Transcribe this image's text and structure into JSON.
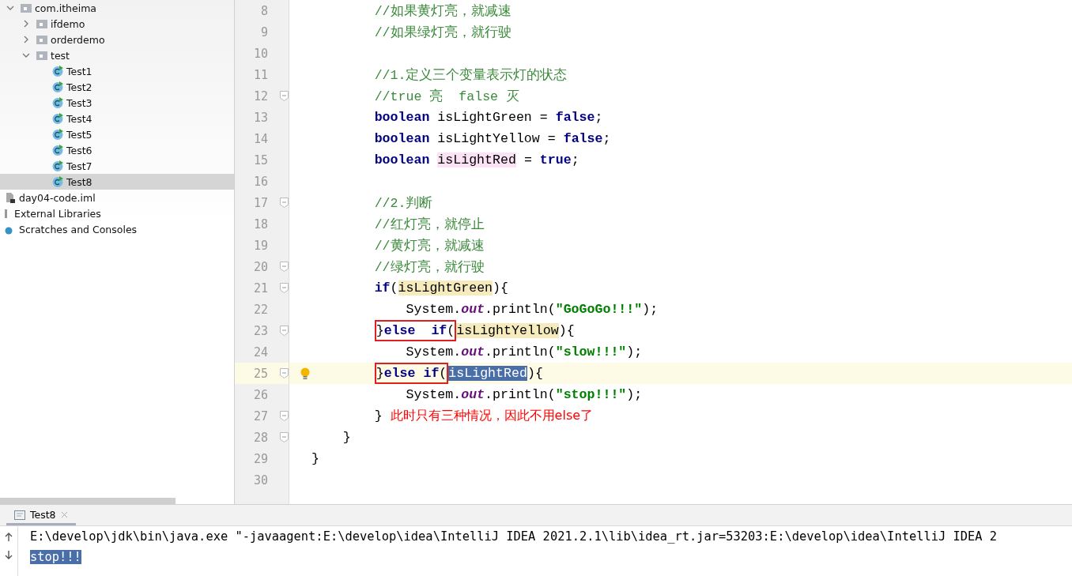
{
  "project_tree": [
    {
      "label": "com.itheima",
      "kind": "package",
      "expanded": true,
      "selected": false,
      "children": [
        {
          "label": "ifdemo",
          "kind": "package",
          "expanded": false,
          "selected": false
        },
        {
          "label": "orderdemo",
          "kind": "package",
          "expanded": false,
          "selected": false
        },
        {
          "label": "test",
          "kind": "package",
          "expanded": true,
          "selected": false,
          "children": [
            {
              "label": "Test1",
              "kind": "class",
              "selected": false
            },
            {
              "label": "Test2",
              "kind": "class",
              "selected": false
            },
            {
              "label": "Test3",
              "kind": "class",
              "selected": false
            },
            {
              "label": "Test4",
              "kind": "class",
              "selected": false
            },
            {
              "label": "Test5",
              "kind": "class",
              "selected": false
            },
            {
              "label": "Test6",
              "kind": "class",
              "selected": false
            },
            {
              "label": "Test7",
              "kind": "class",
              "selected": false
            },
            {
              "label": "Test8",
              "kind": "class",
              "selected": true
            }
          ]
        }
      ]
    },
    {
      "label": "day04-code.iml",
      "kind": "file",
      "selected": false
    },
    {
      "label": "External Libraries",
      "kind": "library",
      "selected": false
    },
    {
      "label": "Scratches and Consoles",
      "kind": "scratch",
      "selected": false
    }
  ],
  "editor": {
    "lines": [
      {
        "n": "8",
        "fold": false,
        "current": false,
        "bulb": false,
        "tokens": [
          {
            "t": "        //如果黄灯亮，就减速",
            "kind": "comment"
          }
        ]
      },
      {
        "n": "9",
        "fold": false,
        "current": false,
        "bulb": false,
        "tokens": [
          {
            "t": "        //如果绿灯亮，就行驶",
            "kind": "comment"
          }
        ]
      },
      {
        "n": "10",
        "fold": false,
        "current": false,
        "bulb": false
      },
      {
        "n": "11",
        "fold": false,
        "current": false,
        "bulb": false,
        "tokens": [
          {
            "t": "        //1.定义三个变量表示灯的状态",
            "kind": "comment"
          }
        ]
      },
      {
        "n": "12",
        "fold": true,
        "current": false,
        "bulb": false,
        "tokens": [
          {
            "t": "        //true 亮  false 灭",
            "kind": "comment"
          }
        ]
      },
      {
        "n": "13",
        "fold": false,
        "current": false,
        "bulb": false,
        "tokens": [
          {
            "t": "        boolean",
            "kind": "kw"
          },
          {
            "t": " isLightGreen = ",
            "kind": "plain"
          },
          {
            "t": "false",
            "kind": "kw"
          },
          {
            "t": ";",
            "kind": "plain"
          }
        ]
      },
      {
        "n": "14",
        "fold": false,
        "current": false,
        "bulb": false,
        "tokens": [
          {
            "t": "        boolean",
            "kind": "kw"
          },
          {
            "t": " isLightYellow = ",
            "kind": "plain"
          },
          {
            "t": "false",
            "kind": "kw"
          },
          {
            "t": ";",
            "kind": "plain"
          }
        ]
      },
      {
        "n": "15",
        "fold": false,
        "current": false,
        "bulb": false,
        "tokens": [
          {
            "t": "        boolean ",
            "kind": "kw"
          },
          {
            "t": "isLightRed",
            "kind": "write"
          },
          {
            "t": " = ",
            "kind": "plain"
          },
          {
            "t": "true",
            "kind": "kw"
          },
          {
            "t": ";",
            "kind": "plain"
          }
        ]
      },
      {
        "n": "16",
        "fold": false,
        "current": false,
        "bulb": false
      },
      {
        "n": "17",
        "fold": true,
        "current": false,
        "bulb": false,
        "tokens": [
          {
            "t": "        //2.判断",
            "kind": "comment"
          }
        ]
      },
      {
        "n": "18",
        "fold": false,
        "current": false,
        "bulb": false,
        "tokens": [
          {
            "t": "        //红灯亮，就停止",
            "kind": "comment"
          }
        ]
      },
      {
        "n": "19",
        "fold": false,
        "current": false,
        "bulb": false,
        "tokens": [
          {
            "t": "        //黄灯亮，就减速",
            "kind": "comment"
          }
        ]
      },
      {
        "n": "20",
        "fold": true,
        "current": false,
        "bulb": false,
        "tokens": [
          {
            "t": "        //绿灯亮，就行驶",
            "kind": "comment"
          }
        ]
      },
      {
        "n": "21",
        "fold": true,
        "current": false,
        "bulb": false,
        "tokens": [
          {
            "t": "        if",
            "kind": "kw"
          },
          {
            "t": "(",
            "kind": "plain"
          },
          {
            "t": "isLightGreen",
            "kind": "read"
          },
          {
            "t": "){",
            "kind": "plain"
          }
        ]
      },
      {
        "n": "22",
        "fold": false,
        "current": false,
        "bulb": false,
        "tokens": [
          {
            "t": "            System.",
            "kind": "plain"
          },
          {
            "t": "out",
            "kind": "field"
          },
          {
            "t": ".println(",
            "kind": "plain"
          },
          {
            "t": "\"GoGoGo!!!\"",
            "kind": "str"
          },
          {
            "t": ");",
            "kind": "plain"
          }
        ]
      },
      {
        "n": "23",
        "fold": true,
        "current": false,
        "bulb": false,
        "tokens": [
          {
            "t": "        }",
            "kind": "plain",
            "boxed": true
          },
          {
            "t": "else  if",
            "kind": "kw",
            "boxed": true
          },
          {
            "t": "(",
            "kind": "plain",
            "boxed": true
          },
          {
            "t": "isLightYellow",
            "kind": "read"
          },
          {
            "t": "){",
            "kind": "plain"
          }
        ]
      },
      {
        "n": "24",
        "fold": false,
        "current": false,
        "bulb": false,
        "tokens": [
          {
            "t": "            System.",
            "kind": "plain"
          },
          {
            "t": "out",
            "kind": "field"
          },
          {
            "t": ".println(",
            "kind": "plain"
          },
          {
            "t": "\"slow!!!\"",
            "kind": "str"
          },
          {
            "t": ");",
            "kind": "plain"
          }
        ]
      },
      {
        "n": "25",
        "fold": true,
        "current": true,
        "bulb": true,
        "tokens": [
          {
            "t": "        }",
            "kind": "plain",
            "boxed": true
          },
          {
            "t": "else if",
            "kind": "kw",
            "boxed": true
          },
          {
            "t": "(",
            "kind": "plain",
            "boxed": true
          },
          {
            "t": "isLightRed",
            "kind": "selected"
          },
          {
            "t": "){",
            "kind": "plain"
          }
        ]
      },
      {
        "n": "26",
        "fold": false,
        "current": false,
        "bulb": false,
        "tokens": [
          {
            "t": "            System.",
            "kind": "plain"
          },
          {
            "t": "out",
            "kind": "field"
          },
          {
            "t": ".println(",
            "kind": "plain"
          },
          {
            "t": "\"stop!!!\"",
            "kind": "str"
          },
          {
            "t": ");",
            "kind": "plain"
          }
        ]
      },
      {
        "n": "27",
        "fold": true,
        "current": false,
        "bulb": false,
        "tokens": [
          {
            "t": "        } ",
            "kind": "plain"
          },
          {
            "t": "此时只有三种情况，因此不用else了",
            "kind": "note"
          }
        ]
      },
      {
        "n": "28",
        "fold": true,
        "current": false,
        "bulb": false,
        "tokens": [
          {
            "t": "    }",
            "kind": "plain"
          }
        ]
      },
      {
        "n": "29",
        "fold": false,
        "current": false,
        "bulb": false,
        "tokens": [
          {
            "t": "}",
            "kind": "plain"
          }
        ]
      },
      {
        "n": "30",
        "fold": false,
        "current": false,
        "bulb": false
      }
    ]
  },
  "run_panel": {
    "tabs": [
      {
        "label": "Test8",
        "selected": true
      }
    ],
    "lines": [
      {
        "text": "E:\\develop\\jdk\\bin\\java.exe \"-javaagent:E:\\develop\\idea\\IntelliJ IDEA 2021.2.1\\lib\\idea_rt.jar=53203:E:\\develop\\idea\\IntelliJ IDEA 2",
        "selected": false
      },
      {
        "text": "stop!!!",
        "selected": true
      }
    ]
  }
}
